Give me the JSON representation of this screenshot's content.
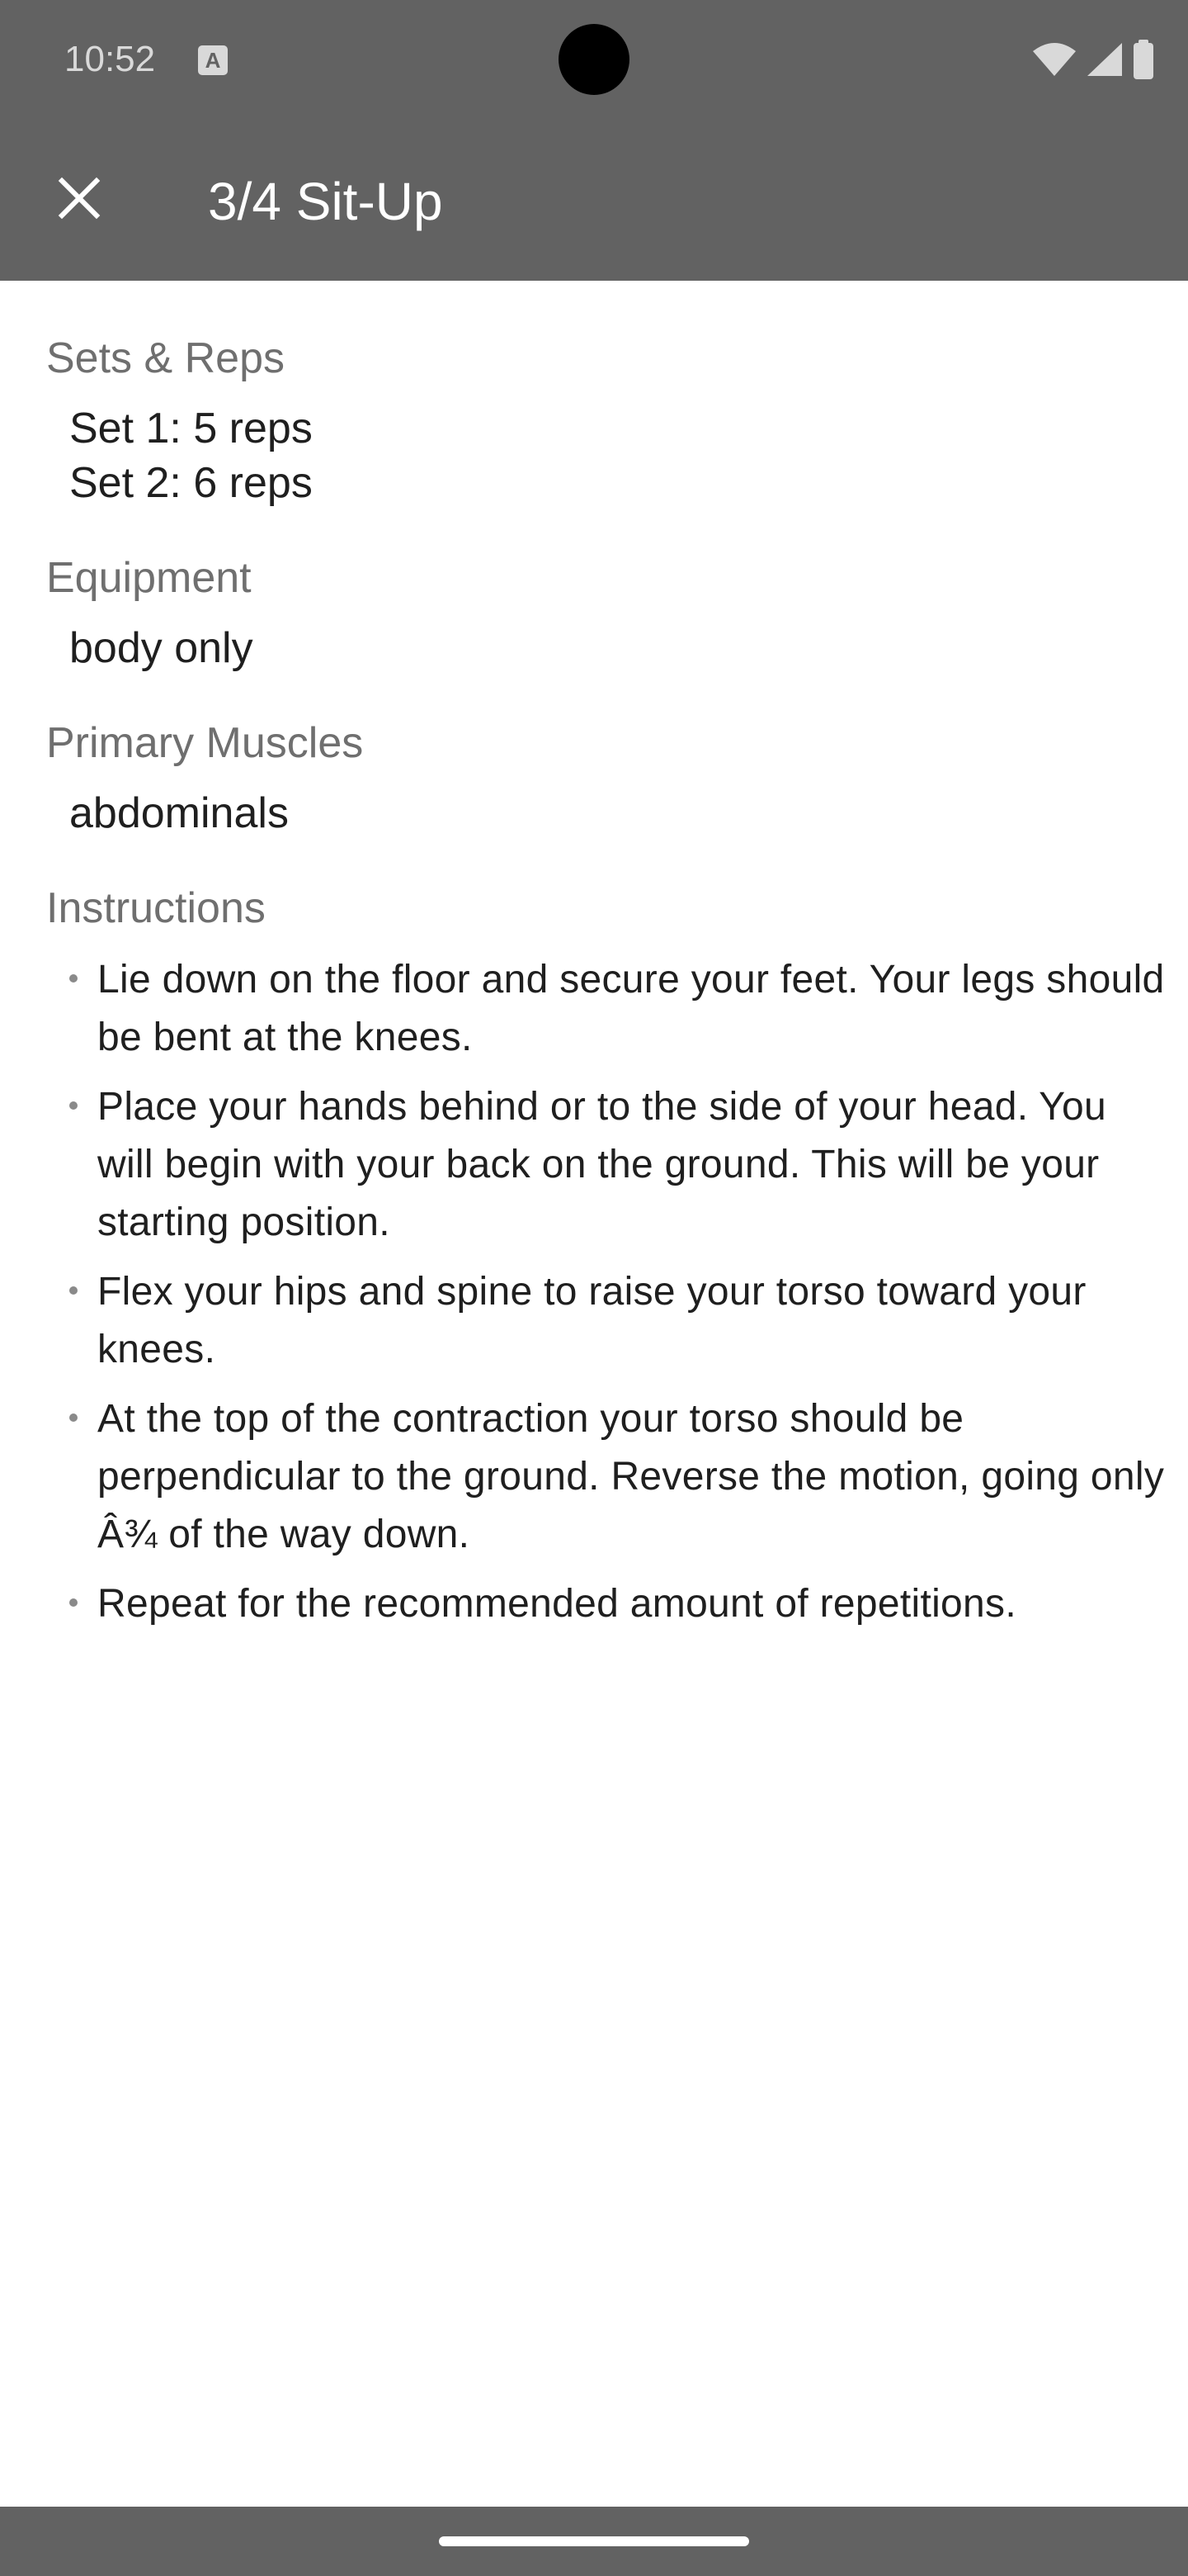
{
  "status_bar": {
    "time": "10:52",
    "notification_icon": "text-a-icon",
    "right_icons": [
      "wifi-icon",
      "cellular-signal-icon",
      "battery-icon"
    ]
  },
  "toolbar": {
    "close_icon": "close-icon",
    "title": "3/4 Sit-Up"
  },
  "sections": {
    "sets_reps": {
      "label": "Sets & Reps",
      "items": [
        "Set 1: 5 reps",
        "Set 2: 6 reps"
      ]
    },
    "equipment": {
      "label": "Equipment",
      "value": "body only"
    },
    "primary_muscles": {
      "label": "Primary Muscles",
      "value": "abdominals"
    },
    "instructions": {
      "label": "Instructions",
      "items": [
        "Lie down on the floor and secure your feet. Your legs should be bent at the knees.",
        "Place your hands behind or to the side of your head. You will begin with your back on the ground. This will be your starting position.",
        "Flex your hips and spine to raise your torso toward your knees.",
        "At the top of the contraction your torso should be perpendicular to the ground. Reverse the motion, going only Â¾ of the way down.",
        "Repeat for the recommended amount of repetitions."
      ]
    }
  },
  "colors": {
    "app_bar": "#626262",
    "label_text": "#6f6f6f",
    "body_text": "#1f1f1f",
    "background": "#ffffff"
  }
}
